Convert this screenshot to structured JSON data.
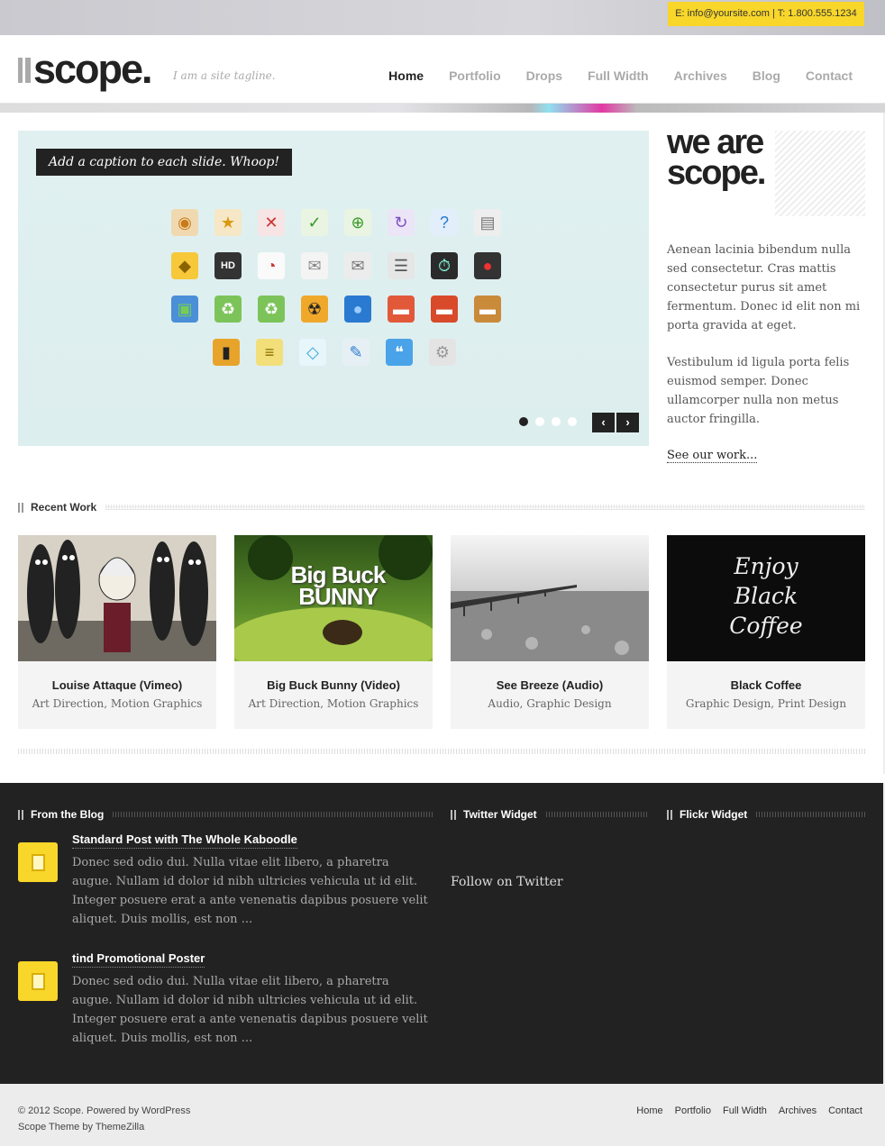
{
  "top": {
    "contact": "E: info@yoursite.com | T: 1.800.555.1234"
  },
  "header": {
    "logo": "scope.",
    "tagline": "I am a site tagline.",
    "nav": [
      "Home",
      "Portfolio",
      "Drops",
      "Full Width",
      "Archives",
      "Blog",
      "Contact"
    ],
    "active_nav": "Home"
  },
  "slider": {
    "caption": "Add a caption to each slide. Whoop!",
    "icons": [
      [
        "rss-icon",
        "star-icon",
        "delete-icon",
        "check-icon",
        "add-page-icon",
        "refresh-icon",
        "help-icon",
        "zip-icon"
      ],
      [
        "road-sign-icon",
        "hd-clapper-icon",
        "presentation-icon",
        "mail-icon",
        "open-mail-icon",
        "sliders-icon",
        "clock-icon",
        "joystick-icon"
      ],
      [
        "picture-icon",
        "recycle-bin-icon",
        "recycle-bin-2-icon",
        "radiation-icon",
        "globe-icon",
        "toolbox-icon",
        "toolbox-2-icon",
        "briefcase-icon"
      ],
      [
        "film-icon",
        "notes-icon",
        "diamond-icon",
        "pen-icon",
        "chat-icon",
        "gear-icon"
      ]
    ],
    "slides": 4,
    "active_slide": 1,
    "prev": "‹",
    "next": "›"
  },
  "about": {
    "heading": "we are scope.",
    "paragraphs": [
      "Aenean lacinia bibendum nulla sed consectetur. Cras mattis consectetur purus sit amet fermentum. Donec id elit non mi porta gravida at eget.",
      "Vestibulum id ligula porta felis euismod semper. Donec ullamcorper nulla non metus auctor fringilla."
    ],
    "link": "See our work..."
  },
  "recent_work": {
    "heading": "Recent Work",
    "items": [
      {
        "title": "Louise Attaque (Vimeo)",
        "cats": "Art Direction, Motion Graphics"
      },
      {
        "title": "Big Buck Bunny (Video)",
        "cats": "Art Direction, Motion Graphics",
        "thumb_text": "Big Buck BUNNY"
      },
      {
        "title": "See Breeze (Audio)",
        "cats": "Audio, Graphic Design"
      },
      {
        "title": "Black Coffee",
        "cats": "Graphic Design, Print Design",
        "thumb_text": "Enjoy Black Coffee"
      }
    ]
  },
  "blog": {
    "heading": "From the Blog",
    "posts": [
      {
        "title": "Standard Post with The Whole Kaboodle",
        "body": "Donec sed odio dui. Nulla vitae elit libero, a pharetra augue. Nullam id dolor id nibh ultricies vehicula ut id elit. Integer posuere erat a ante venenatis dapibus posuere velit aliquet. Duis mollis, est non ..."
      },
      {
        "title": "tind Promotional Poster",
        "body": "Donec sed odio dui. Nulla vitae elit libero, a pharetra augue. Nullam id dolor id nibh ultricies vehicula ut id elit. Integer posuere erat a ante venenatis dapibus posuere velit aliquet. Duis mollis, est non ..."
      }
    ]
  },
  "twitter": {
    "heading": "Twitter Widget",
    "follow": "Follow on Twitter"
  },
  "flickr": {
    "heading": "Flickr Widget"
  },
  "footer": {
    "copyright": "© 2012 Scope. Powered by WordPress",
    "theme": "Scope Theme by ThemeZilla",
    "nav": [
      "Home",
      "Portfolio",
      "Full Width",
      "Archives",
      "Contact"
    ]
  },
  "colors": {
    "accent": "#f8d62a",
    "dark": "#222222",
    "slider_bg": "#e0f0f1"
  }
}
